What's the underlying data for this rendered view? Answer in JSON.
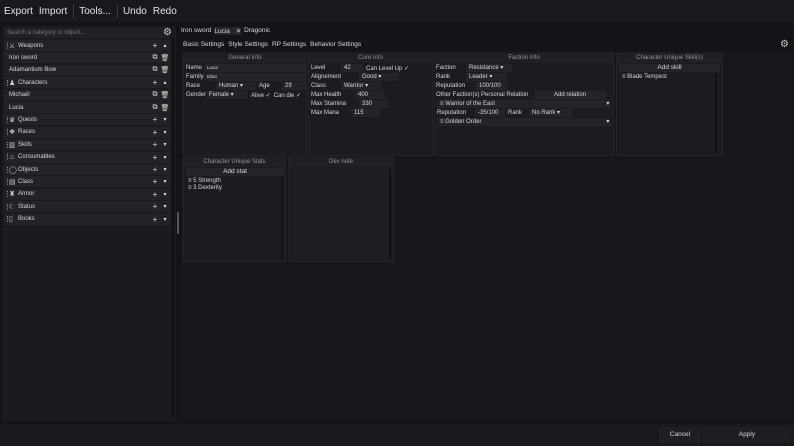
{
  "menu": [
    "Export",
    "Import",
    "Tools...",
    "Undo",
    "Redo"
  ],
  "search": {
    "placeholder": "Search a category or object..."
  },
  "sidebar": [
    {
      "type": "cat",
      "label": "Weapons",
      "icon": "sword-icon",
      "glyph": "⚔",
      "expanded": true
    },
    {
      "type": "item",
      "label": "Iron sword"
    },
    {
      "type": "item",
      "label": "Adamantium Bow"
    },
    {
      "type": "cat",
      "label": "Characters",
      "icon": "person-icon",
      "glyph": "♟",
      "expanded": true
    },
    {
      "type": "item",
      "label": "Michaël"
    },
    {
      "type": "item",
      "label": "Lucia"
    },
    {
      "type": "cat",
      "label": "Quests",
      "icon": "crown-icon",
      "glyph": "♛"
    },
    {
      "type": "cat",
      "label": "Races",
      "icon": "paw-icon",
      "glyph": "❖"
    },
    {
      "type": "cat",
      "label": "Skills",
      "icon": "skills-icon",
      "glyph": "▥"
    },
    {
      "type": "cat",
      "label": "Consumables",
      "icon": "potion-icon",
      "glyph": "♨"
    },
    {
      "type": "cat",
      "label": "Objects",
      "icon": "bag-icon",
      "glyph": "◯"
    },
    {
      "type": "cat",
      "label": "Class",
      "icon": "class-icon",
      "glyph": "▤"
    },
    {
      "type": "cat",
      "label": "Armor",
      "icon": "armor-icon",
      "glyph": "♜"
    },
    {
      "type": "cat",
      "label": "Status",
      "icon": "status-icon",
      "glyph": "☾"
    },
    {
      "type": "cat",
      "label": "Books",
      "icon": "book-icon",
      "glyph": "▯"
    }
  ],
  "tabs": [
    {
      "label": "Iron sword"
    },
    {
      "label": "Lucia",
      "active": true,
      "close": "✕"
    },
    {
      "label": "Dragonic"
    }
  ],
  "subtabs": [
    "Basic Settings",
    "Style Settings",
    "RP Settings",
    "Behavior Settings"
  ],
  "general": {
    "title": "General Info",
    "name_label": "Name",
    "name": "Lucia",
    "family_label": "Family",
    "family": "Elian",
    "race_label": "Race",
    "race": "Human",
    "age_label": "Age",
    "age": "29",
    "gender_label": "Gender",
    "gender": "Female",
    "alive": "Alive ✓",
    "candie": "Can die ✓"
  },
  "core": {
    "title": "Core Info",
    "level_label": "Level",
    "level": "42",
    "canlevel": "Can Level Up ✓",
    "align_label": "Alignement",
    "align": "Good",
    "class_label": "Class",
    "class": "Warrior",
    "hp_label": "Max Health",
    "hp": "400",
    "st_label": "Max Stamina",
    "st": "330",
    "mana_label": "Max Mana",
    "mana": "115"
  },
  "faction": {
    "title": "Faction Info",
    "faction_label": "Faction",
    "faction": "Resistance",
    "rank_label": "Rank",
    "rank": "Leader",
    "rep_label": "Reputation",
    "rep": "100/100",
    "other_label": "Other Faction(s) Personal  Relation",
    "add": "Add relation",
    "rel": [
      {
        "name": "Warrior of the East",
        "rep_label": "Reputation",
        "rep": "-35/100",
        "rank_label": "Rank",
        "rank": "No Rank"
      },
      {
        "name": "Golden Order"
      }
    ]
  },
  "skills": {
    "title": "Character Unique Skill(s)",
    "add": "Add skill",
    "items": [
      "Blade Tempest"
    ]
  },
  "stats": {
    "title": "Character Unique Stats",
    "add": "Add stat",
    "items": [
      "5 Strength",
      "3 Dexterity"
    ]
  },
  "devnote": {
    "title": "Dev note"
  },
  "footer": {
    "cancel": "Cancel",
    "apply": "Apply"
  }
}
